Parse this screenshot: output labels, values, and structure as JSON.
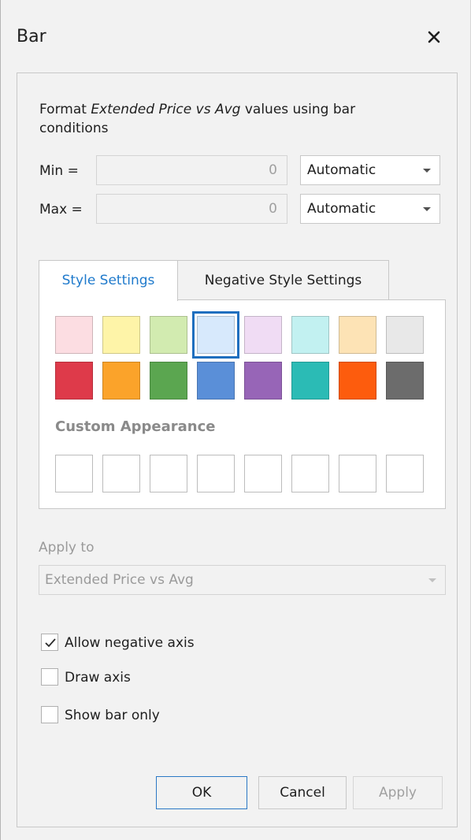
{
  "window": {
    "title": "Bar"
  },
  "description": {
    "prefix": "Format ",
    "field": "Extended Price vs Avg",
    "suffix": " values using bar conditions"
  },
  "min": {
    "label": "Min =",
    "value": "0",
    "mode": "Automatic"
  },
  "max": {
    "label": "Max =",
    "value": "0",
    "mode": "Automatic"
  },
  "tabs": {
    "active": "Style Settings",
    "inactive": "Negative Style Settings"
  },
  "style_panel": {
    "light_colors": [
      "#fcdde2",
      "#fef4a8",
      "#d2ebb0",
      "#d7e9fc",
      "#f0dcf4",
      "#c2f1f1",
      "#fde3b5",
      "#e8e8e8"
    ],
    "dark_colors": [
      "#de3a4a",
      "#fba32a",
      "#5ba650",
      "#5a8fd8",
      "#9765b7",
      "#2bbbb5",
      "#fd5c0d",
      "#6c6c6c"
    ],
    "selected_index": 3,
    "custom_label": "Custom Appearance"
  },
  "apply_to": {
    "label": "Apply to",
    "value": "Extended Price vs Avg"
  },
  "options": [
    {
      "label": "Allow negative axis",
      "checked": true
    },
    {
      "label": "Draw axis",
      "checked": false
    },
    {
      "label": "Show bar only",
      "checked": false
    }
  ],
  "buttons": {
    "ok": "OK",
    "cancel": "Cancel",
    "apply": "Apply"
  }
}
